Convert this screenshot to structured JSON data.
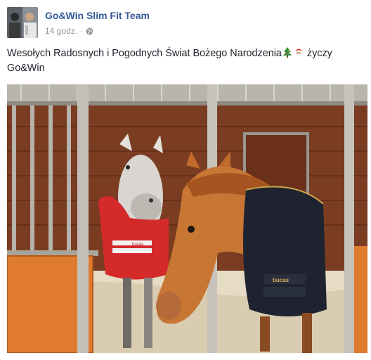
{
  "post": {
    "author": "Go&Win Slim Fit Team",
    "timestamp": "14 godz.",
    "separator": "·",
    "privacy_icon": "globe-icon",
    "text_main": "Wesołych Radosnych i Pogodnych Świat Bożego Narodzenia",
    "emojis": [
      "christmas-tree-icon",
      "santa-icon"
    ],
    "text_tail": " życzy Go&Win",
    "photo": {
      "blanket_left_text": "bucas",
      "blanket_right_text": "bucas"
    }
  },
  "colors": {
    "link": "#365899",
    "meta": "#90949c",
    "text": "#1d2129"
  }
}
